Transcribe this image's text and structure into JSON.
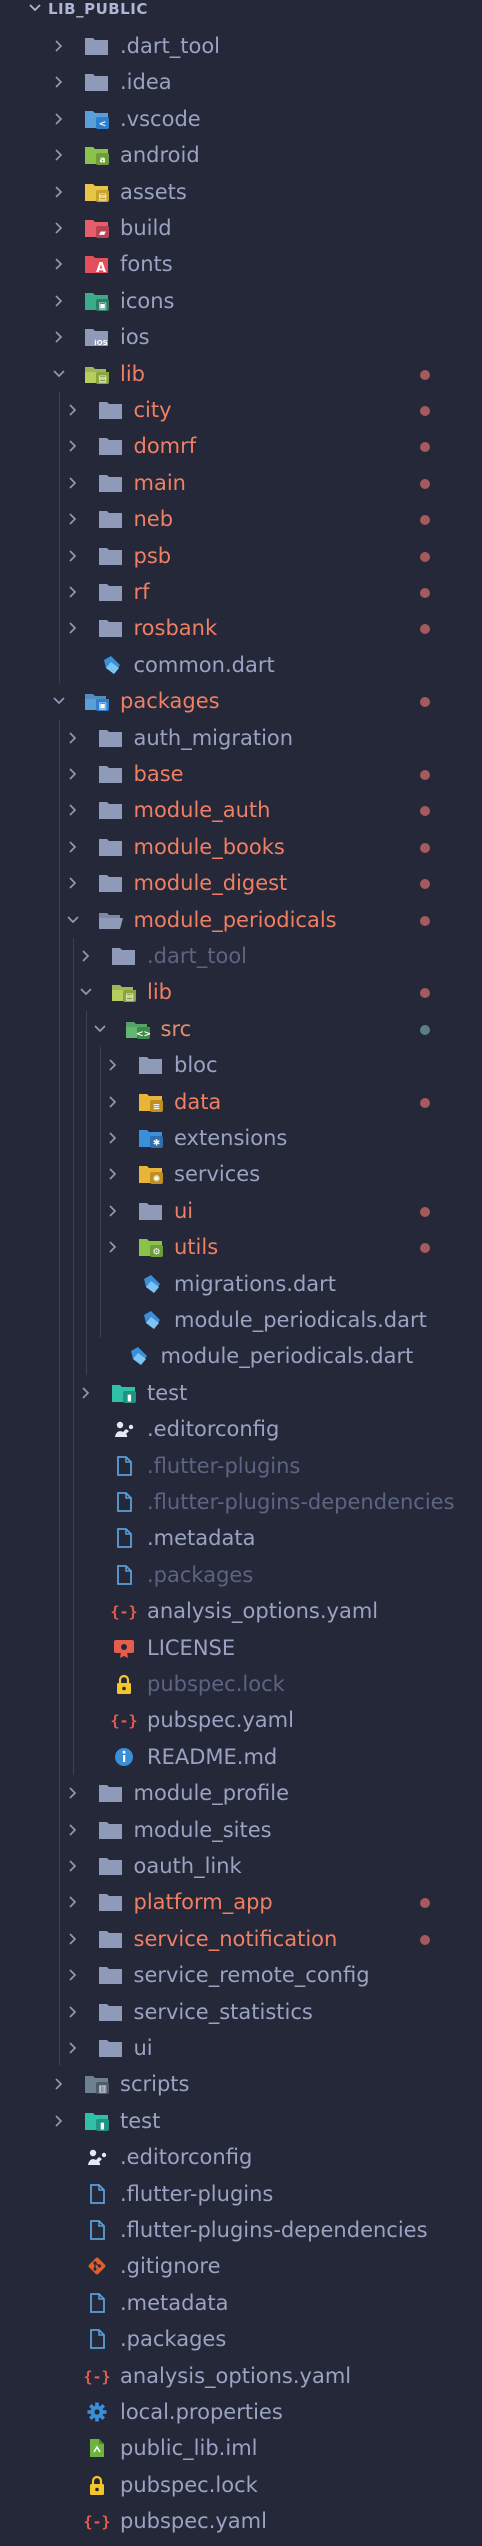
{
  "explorer": {
    "section_title": "LIB_PUBLIC",
    "colors": {
      "background": "#252838",
      "text_default": "#9aa3c2",
      "text_modified": "#f07f63",
      "text_dimmed": "#5c6482",
      "text_highlight": "#e28f6a",
      "dot_modified": "#a55a5c",
      "dot_src": "#5a7f86"
    },
    "items": [
      {
        "label": ".dart_tool",
        "depth": 0,
        "type": "folder",
        "expanded": false,
        "icon": "folder-icon",
        "status": "normal"
      },
      {
        "label": ".idea",
        "depth": 0,
        "type": "folder",
        "expanded": false,
        "icon": "folder-icon",
        "status": "normal"
      },
      {
        "label": ".vscode",
        "depth": 0,
        "type": "folder",
        "expanded": false,
        "icon": "folder-vscode-icon",
        "status": "normal"
      },
      {
        "label": "android",
        "depth": 0,
        "type": "folder",
        "expanded": false,
        "icon": "folder-android-icon",
        "status": "normal"
      },
      {
        "label": "assets",
        "depth": 0,
        "type": "folder",
        "expanded": false,
        "icon": "folder-assets-icon",
        "status": "normal"
      },
      {
        "label": "build",
        "depth": 0,
        "type": "folder",
        "expanded": false,
        "icon": "folder-build-icon",
        "status": "normal"
      },
      {
        "label": "fonts",
        "depth": 0,
        "type": "folder",
        "expanded": false,
        "icon": "folder-fonts-icon",
        "status": "normal"
      },
      {
        "label": "icons",
        "depth": 0,
        "type": "folder",
        "expanded": false,
        "icon": "folder-images-icon",
        "status": "normal"
      },
      {
        "label": "ios",
        "depth": 0,
        "type": "folder",
        "expanded": false,
        "icon": "folder-ios-icon",
        "status": "normal"
      },
      {
        "label": "lib",
        "depth": 0,
        "type": "folder",
        "expanded": true,
        "icon": "folder-lib-open-icon",
        "status": "modified"
      },
      {
        "label": "city",
        "depth": 1,
        "type": "folder",
        "expanded": false,
        "icon": "folder-icon",
        "status": "modified"
      },
      {
        "label": "domrf",
        "depth": 1,
        "type": "folder",
        "expanded": false,
        "icon": "folder-icon",
        "status": "modified"
      },
      {
        "label": "main",
        "depth": 1,
        "type": "folder",
        "expanded": false,
        "icon": "folder-icon",
        "status": "modified"
      },
      {
        "label": "neb",
        "depth": 1,
        "type": "folder",
        "expanded": false,
        "icon": "folder-icon",
        "status": "modified"
      },
      {
        "label": "psb",
        "depth": 1,
        "type": "folder",
        "expanded": false,
        "icon": "folder-icon",
        "status": "modified"
      },
      {
        "label": "rf",
        "depth": 1,
        "type": "folder",
        "expanded": false,
        "icon": "folder-icon",
        "status": "modified"
      },
      {
        "label": "rosbank",
        "depth": 1,
        "type": "folder",
        "expanded": false,
        "icon": "folder-icon",
        "status": "modified"
      },
      {
        "label": "common.dart",
        "depth": 1,
        "type": "file",
        "icon": "dart-file-icon",
        "status": "normal"
      },
      {
        "label": "packages",
        "depth": 0,
        "type": "folder",
        "expanded": true,
        "icon": "folder-packages-open-icon",
        "status": "modified"
      },
      {
        "label": "auth_migration",
        "depth": 1,
        "type": "folder",
        "expanded": false,
        "icon": "folder-icon",
        "status": "normal"
      },
      {
        "label": "base",
        "depth": 1,
        "type": "folder",
        "expanded": false,
        "icon": "folder-icon",
        "status": "modified"
      },
      {
        "label": "module_auth",
        "depth": 1,
        "type": "folder",
        "expanded": false,
        "icon": "folder-icon",
        "status": "modified"
      },
      {
        "label": "module_books",
        "depth": 1,
        "type": "folder",
        "expanded": false,
        "icon": "folder-icon",
        "status": "modified"
      },
      {
        "label": "module_digest",
        "depth": 1,
        "type": "folder",
        "expanded": false,
        "icon": "folder-icon",
        "status": "modified"
      },
      {
        "label": "module_periodicals",
        "depth": 1,
        "type": "folder",
        "expanded": true,
        "icon": "folder-open-icon",
        "status": "modified"
      },
      {
        "label": ".dart_tool",
        "depth": 2,
        "type": "folder",
        "expanded": false,
        "icon": "folder-icon",
        "status": "dimmed"
      },
      {
        "label": "lib",
        "depth": 2,
        "type": "folder",
        "expanded": true,
        "icon": "folder-lib-open-icon",
        "status": "modified"
      },
      {
        "label": "src",
        "depth": 3,
        "type": "folder",
        "expanded": true,
        "icon": "folder-src-open-icon",
        "status": "src"
      },
      {
        "label": "bloc",
        "depth": 4,
        "type": "folder",
        "expanded": false,
        "icon": "folder-icon",
        "status": "normal"
      },
      {
        "label": "data",
        "depth": 4,
        "type": "folder",
        "expanded": false,
        "icon": "folder-database-icon",
        "status": "modified"
      },
      {
        "label": "extensions",
        "depth": 4,
        "type": "folder",
        "expanded": false,
        "icon": "folder-extensions-icon",
        "status": "normal"
      },
      {
        "label": "services",
        "depth": 4,
        "type": "folder",
        "expanded": false,
        "icon": "folder-services-icon",
        "status": "normal"
      },
      {
        "label": "ui",
        "depth": 4,
        "type": "folder",
        "expanded": false,
        "icon": "folder-icon",
        "status": "modified"
      },
      {
        "label": "utils",
        "depth": 4,
        "type": "folder",
        "expanded": false,
        "icon": "folder-utils-icon",
        "status": "modified"
      },
      {
        "label": "migrations.dart",
        "depth": 4,
        "type": "file",
        "icon": "dart-file-icon",
        "status": "normal"
      },
      {
        "label": "module_periodicals.dart",
        "depth": 4,
        "type": "file",
        "icon": "dart-file-icon",
        "status": "normal"
      },
      {
        "label": "module_periodicals.dart",
        "depth": 3,
        "type": "file",
        "icon": "dart-file-icon",
        "status": "normal"
      },
      {
        "label": "test",
        "depth": 2,
        "type": "folder",
        "expanded": false,
        "icon": "folder-test-icon",
        "status": "normal"
      },
      {
        "label": ".editorconfig",
        "depth": 2,
        "type": "file",
        "icon": "editorconfig-icon",
        "status": "normal"
      },
      {
        "label": ".flutter-plugins",
        "depth": 2,
        "type": "file",
        "icon": "document-icon",
        "status": "dimmed"
      },
      {
        "label": ".flutter-plugins-dependencies",
        "depth": 2,
        "type": "file",
        "icon": "document-icon",
        "status": "dimmed"
      },
      {
        "label": ".metadata",
        "depth": 2,
        "type": "file",
        "icon": "document-icon",
        "status": "normal"
      },
      {
        "label": ".packages",
        "depth": 2,
        "type": "file",
        "icon": "document-icon",
        "status": "dimmed"
      },
      {
        "label": "analysis_options.yaml",
        "depth": 2,
        "type": "file",
        "icon": "yaml-icon",
        "status": "normal"
      },
      {
        "label": "LICENSE",
        "depth": 2,
        "type": "file",
        "icon": "license-icon",
        "status": "normal"
      },
      {
        "label": "pubspec.lock",
        "depth": 2,
        "type": "file",
        "icon": "lock-icon",
        "status": "dimmed"
      },
      {
        "label": "pubspec.yaml",
        "depth": 2,
        "type": "file",
        "icon": "yaml-icon",
        "status": "normal"
      },
      {
        "label": "README.md",
        "depth": 2,
        "type": "file",
        "icon": "info-icon",
        "status": "normal"
      },
      {
        "label": "module_profile",
        "depth": 1,
        "type": "folder",
        "expanded": false,
        "icon": "folder-icon",
        "status": "normal"
      },
      {
        "label": "module_sites",
        "depth": 1,
        "type": "folder",
        "expanded": false,
        "icon": "folder-icon",
        "status": "normal"
      },
      {
        "label": "oauth_link",
        "depth": 1,
        "type": "folder",
        "expanded": false,
        "icon": "folder-icon",
        "status": "normal"
      },
      {
        "label": "platform_app",
        "depth": 1,
        "type": "folder",
        "expanded": false,
        "icon": "folder-icon",
        "status": "modified"
      },
      {
        "label": "service_notification",
        "depth": 1,
        "type": "folder",
        "expanded": false,
        "icon": "folder-icon",
        "status": "modified"
      },
      {
        "label": "service_remote_config",
        "depth": 1,
        "type": "folder",
        "expanded": false,
        "icon": "folder-icon",
        "status": "normal"
      },
      {
        "label": "service_statistics",
        "depth": 1,
        "type": "folder",
        "expanded": false,
        "icon": "folder-icon",
        "status": "normal"
      },
      {
        "label": "ui",
        "depth": 1,
        "type": "folder",
        "expanded": false,
        "icon": "folder-icon",
        "status": "normal"
      },
      {
        "label": "scripts",
        "depth": 0,
        "type": "folder",
        "expanded": false,
        "icon": "folder-scripts-icon",
        "status": "normal"
      },
      {
        "label": "test",
        "depth": 0,
        "type": "folder",
        "expanded": false,
        "icon": "folder-test-icon",
        "status": "normal"
      },
      {
        "label": ".editorconfig",
        "depth": 0,
        "type": "file",
        "icon": "editorconfig-icon",
        "status": "normal"
      },
      {
        "label": ".flutter-plugins",
        "depth": 0,
        "type": "file",
        "icon": "document-icon",
        "status": "normal"
      },
      {
        "label": ".flutter-plugins-dependencies",
        "depth": 0,
        "type": "file",
        "icon": "document-icon",
        "status": "normal"
      },
      {
        "label": ".gitignore",
        "depth": 0,
        "type": "file",
        "icon": "git-icon",
        "status": "normal"
      },
      {
        "label": ".metadata",
        "depth": 0,
        "type": "file",
        "icon": "document-icon",
        "status": "normal"
      },
      {
        "label": ".packages",
        "depth": 0,
        "type": "file",
        "icon": "document-icon",
        "status": "normal"
      },
      {
        "label": "analysis_options.yaml",
        "depth": 0,
        "type": "file",
        "icon": "yaml-icon",
        "status": "normal"
      },
      {
        "label": "local.properties",
        "depth": 0,
        "type": "file",
        "icon": "gear-icon",
        "status": "normal"
      },
      {
        "label": "public_lib.iml",
        "depth": 0,
        "type": "file",
        "icon": "iml-icon",
        "status": "normal"
      },
      {
        "label": "pubspec.lock",
        "depth": 0,
        "type": "file",
        "icon": "lock-icon",
        "status": "normal"
      },
      {
        "label": "pubspec.yaml",
        "depth": 0,
        "type": "file",
        "icon": "yaml-icon",
        "status": "normal"
      }
    ]
  }
}
